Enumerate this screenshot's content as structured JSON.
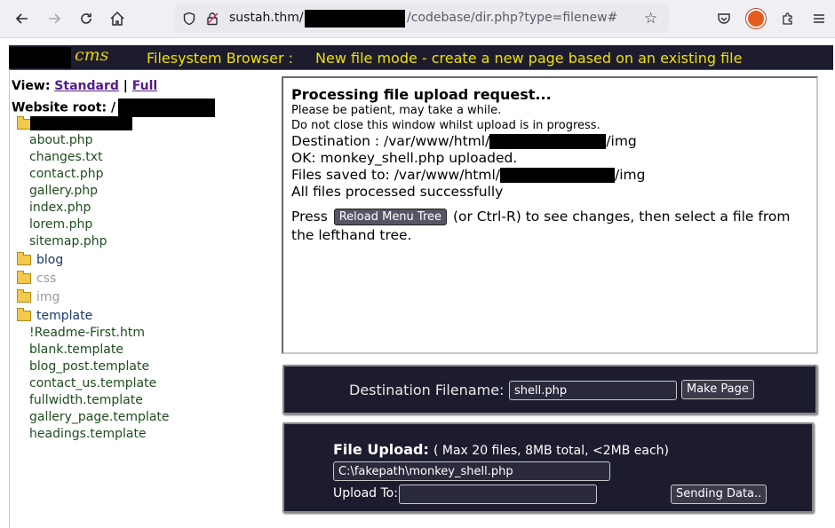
{
  "browser": {
    "url_host": "sustah.thm/",
    "url_path": "/codebase/dir.php?type=filenew#"
  },
  "header": {
    "logo_text": "cms",
    "title": "Filesystem Browser :",
    "mode": "New file mode - create a new page based on an existing file"
  },
  "sidebar": {
    "view_label": "View:",
    "view_standard": "Standard",
    "view_separator": "|",
    "view_full": "Full",
    "root_label": "Website root:",
    "root_prefix": "/",
    "root_files": [
      "about.php",
      "changes.txt",
      "contact.php",
      "gallery.php",
      "index.php",
      "lorem.php",
      "sitemap.php"
    ],
    "folders": [
      {
        "name": "blog",
        "state": "normal"
      },
      {
        "name": "css",
        "state": "dimmed"
      },
      {
        "name": "img",
        "state": "dimmed"
      },
      {
        "name": "template",
        "state": "normal"
      }
    ],
    "template_files": [
      "!Readme-First.htm",
      "blank.template",
      "blog_post.template",
      "contact_us.template",
      "fullwidth.template",
      "gallery_page.template",
      "headings.template"
    ]
  },
  "output": {
    "heading": "Processing file upload request...",
    "line1": "Please be patient, may take a while.",
    "line2": "Do not close this window whilst upload is in progress.",
    "dest_prefix": "Destination : /var/www/html/",
    "dest_suffix": "/img",
    "ok_line": "OK: monkey_shell.php uploaded.",
    "saved_prefix": "Files saved to: /var/www/html/",
    "saved_suffix": "/img",
    "all_done": "All files processed successfully",
    "press_before": "Press",
    "reload_button": "Reload Menu Tree",
    "press_after": "(or Ctrl-R) to see changes, then select a file from the lefthand tree."
  },
  "destination": {
    "label": "Destination Filename:",
    "value": "shell.php",
    "button": "Make Page"
  },
  "upload": {
    "title": "File Upload:",
    "limits": "( Max 20 files, 8MB total, <2MB each)",
    "file_value": "C:\\fakepath\\monkey_shell.php",
    "upload_to_label": "Upload To:",
    "upload_to_value": "",
    "button": "Sending Data.."
  },
  "icons": {
    "back": "back-arrow-icon",
    "forward": "forward-arrow-icon",
    "reload": "reload-icon",
    "home": "home-icon",
    "shield": "tracking-shield-icon",
    "lock": "insecure-lock-icon",
    "star": "bookmark-star-icon",
    "pocket": "pocket-icon",
    "extension": "extension-fox-icon",
    "puzzle": "extensions-puzzle-icon",
    "menu": "hamburger-menu-icon",
    "folder": "folder-icon"
  }
}
